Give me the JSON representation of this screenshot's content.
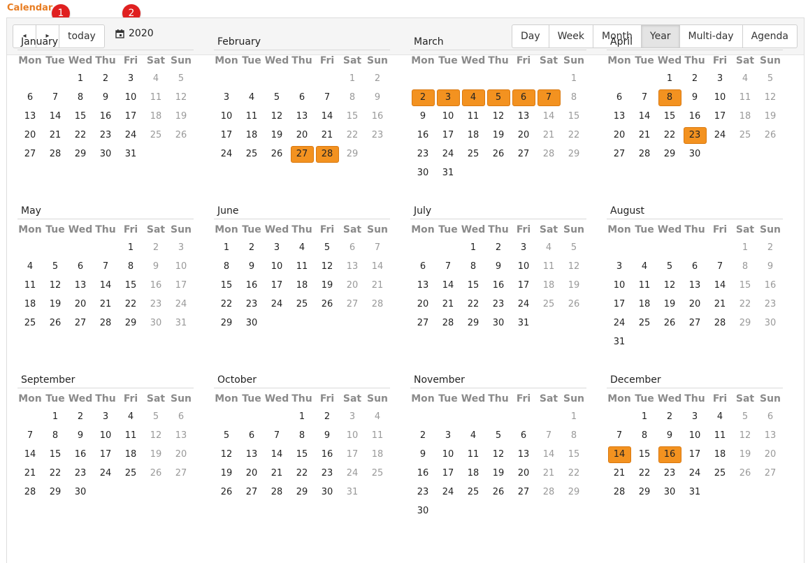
{
  "app_title": "Calendar",
  "markers": [
    "1",
    "2"
  ],
  "toolbar": {
    "prev_icon": "◂",
    "next_icon": "▸",
    "today_label": "today",
    "year": "2020",
    "views": [
      "Day",
      "Week",
      "Month",
      "Year",
      "Multi-day",
      "Agenda"
    ],
    "active_view": "Year"
  },
  "weekday_headers": [
    "Mon",
    "Tue",
    "Wed",
    "Thu",
    "Fri",
    "Sat",
    "Sun"
  ],
  "colors": {
    "accent": "#e87d22",
    "highlight": "#f39220",
    "marker": "#e02020"
  },
  "months": [
    {
      "name": "January",
      "offset": 2,
      "days": 31,
      "highlighted": []
    },
    {
      "name": "February",
      "offset": 5,
      "days": 29,
      "highlighted": [
        27,
        28
      ]
    },
    {
      "name": "March",
      "offset": 6,
      "days": 31,
      "highlighted": [
        2,
        3,
        4,
        5,
        6,
        7
      ]
    },
    {
      "name": "April",
      "offset": 2,
      "days": 30,
      "highlighted": [
        8,
        23
      ]
    },
    {
      "name": "May",
      "offset": 4,
      "days": 31,
      "highlighted": []
    },
    {
      "name": "June",
      "offset": 0,
      "days": 30,
      "highlighted": []
    },
    {
      "name": "July",
      "offset": 2,
      "days": 31,
      "highlighted": []
    },
    {
      "name": "August",
      "offset": 5,
      "days": 31,
      "highlighted": []
    },
    {
      "name": "September",
      "offset": 1,
      "days": 30,
      "highlighted": []
    },
    {
      "name": "October",
      "offset": 3,
      "days": 31,
      "highlighted": []
    },
    {
      "name": "November",
      "offset": 6,
      "days": 30,
      "highlighted": []
    },
    {
      "name": "December",
      "offset": 1,
      "days": 31,
      "highlighted": [
        14,
        16
      ]
    }
  ]
}
